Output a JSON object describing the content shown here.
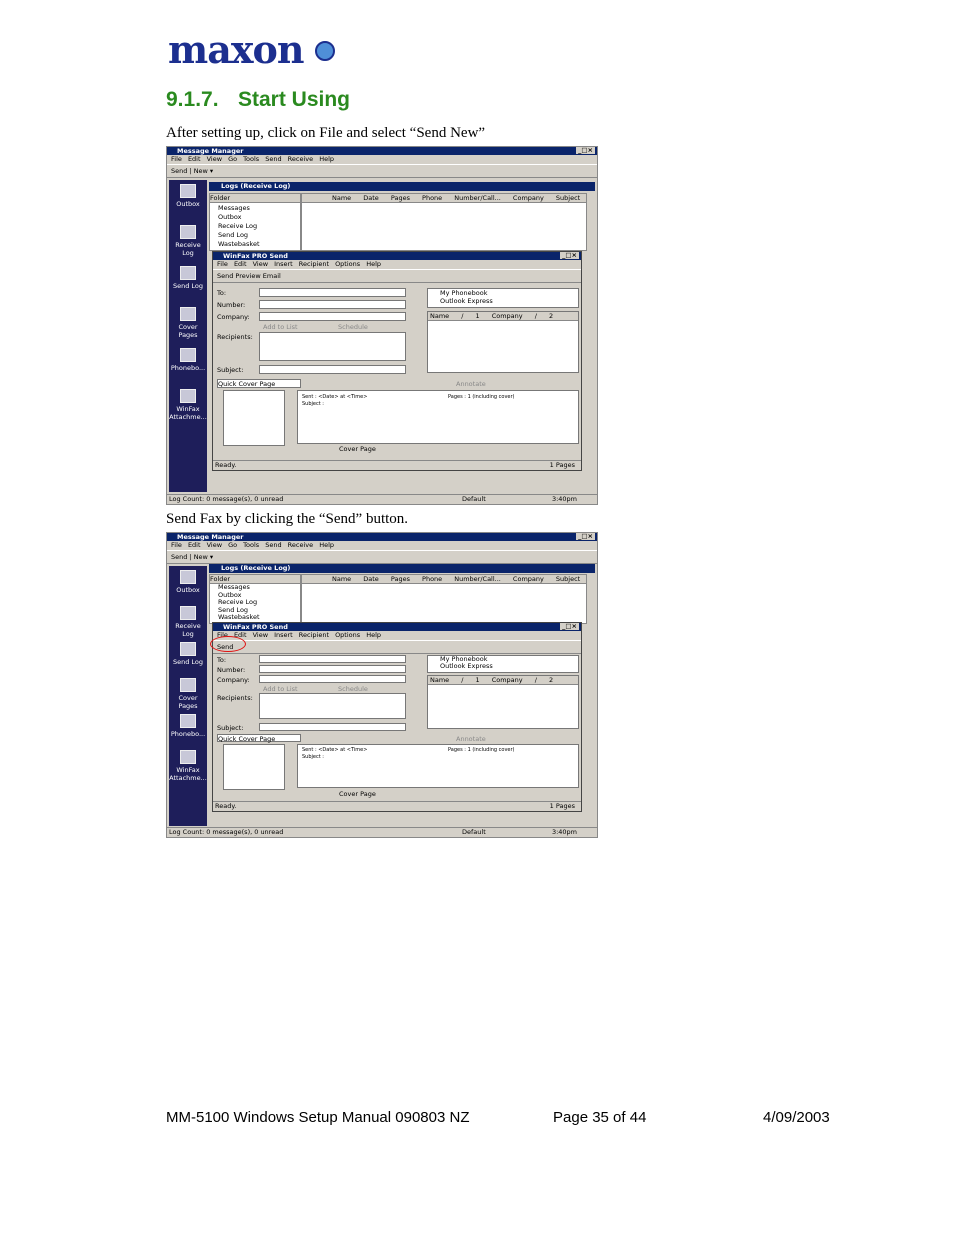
{
  "logo": {
    "text": "maxon"
  },
  "section": {
    "number": "9.1.7.",
    "title": "Start Using"
  },
  "para1": "After setting up, click on File and select “Send New”",
  "para2": "Send Fax by clicking the “Send” button.",
  "app": {
    "title": "Message Manager",
    "window_controls": "_□×",
    "menu": "File Edit View Go Tools Send Receive Help",
    "toolbar": "Send | New ▾",
    "sidebar": [
      "Outbox",
      "Receive Log",
      "Send Log",
      "Cover Pages",
      "Phonebo...",
      "WinFax Attachme..."
    ],
    "logs_title": "Logs (Receive Log)",
    "folder_label": "Folder",
    "columns": "Name Date Pages Phone Number/Call... Company Subject",
    "tree": [
      "Messages",
      "Outbox",
      "Receive Log",
      "Send Log",
      "Wastebasket"
    ],
    "status_left": "Log Count: 0 message(s), 0 unread",
    "status_default": "Default",
    "status_time": "3:40pm"
  },
  "send": {
    "title": "WinFax PRO Send",
    "menu": "File Edit View Insert Recipient Options Help",
    "toolbar": "Send Preview Email",
    "send_label": "Send",
    "to": "To:",
    "number": "Number:",
    "company": "Company:",
    "recipients": "Recipients:",
    "subject": "Subject:",
    "add_to_list": "Add to List",
    "schedule": "Schedule",
    "phonebook": [
      "My Phonebook",
      "Outlook Express"
    ],
    "list_cols": "Name / 1     Company / 2",
    "cover": "Quick Cover Page",
    "annotate": "Annotate",
    "sent_line": "Sent :  <Date> at <Time>",
    "pages_line": "Pages :  1 (including cover)",
    "subject_line": "Subject :",
    "cover_page_tab": "Cover Page",
    "ready": "Ready.",
    "pages": "1 Pages"
  },
  "footer": {
    "left": "MM-5100 Windows Setup Manual 090803 NZ",
    "center": "Page 35 of 44",
    "right": "4/09/2003"
  }
}
